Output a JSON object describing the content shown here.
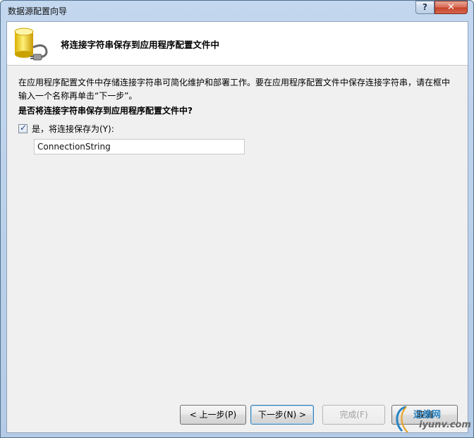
{
  "window": {
    "title": "数据源配置向导",
    "help_label": "?",
    "close_label": "✕"
  },
  "header": {
    "title": "将连接字符串保存到应用程序配置文件中",
    "icon": "database-plug-icon"
  },
  "body": {
    "description_line1": "在应用程序配置文件中存储连接字符串可简化维护和部署工作。要在应用程序配置文件中保存连接字符串，请在框中",
    "description_line2": "输入一个名称再单击“下一步”。",
    "question": "是否将连接字符串保存到应用程序配置文件中?",
    "checkbox_label": "是，将连接保存为(Y):",
    "checkbox_checked": true,
    "connection_name": "ConnectionString"
  },
  "buttons": {
    "prev": "< 上一步(P)",
    "next": "下一步(N) >",
    "finish": "完成(F)",
    "cancel": "取消"
  },
  "watermark": {
    "line1": "运维网",
    "line2": "iyunv.com"
  },
  "colors": {
    "title_bar": "#b9cfe8",
    "close_button": "#c7452b",
    "accent": "#3c7fb1"
  }
}
